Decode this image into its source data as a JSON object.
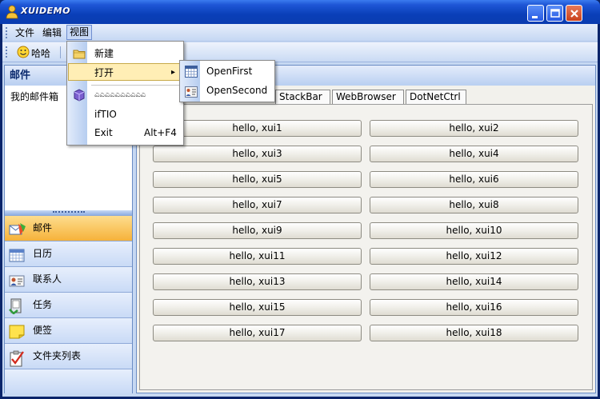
{
  "window": {
    "title": "XUIDEMO",
    "minimize_icon": "minimize-icon",
    "maximize_icon": "maximize-icon",
    "close_icon": "close-icon"
  },
  "menubar": {
    "items": [
      {
        "label": "文件"
      },
      {
        "label": "编辑"
      },
      {
        "label": "视图"
      }
    ]
  },
  "toolbar": {
    "items": [
      {
        "label": "哈哈",
        "icon": "smiley-icon"
      }
    ]
  },
  "left_panel": {
    "header": "邮件",
    "tree_item": "我的邮件箱",
    "nav": [
      {
        "label": "邮件",
        "icon": "mail-icon",
        "active": true
      },
      {
        "label": "日历",
        "icon": "calendar-icon",
        "active": false
      },
      {
        "label": "联系人",
        "icon": "contact-card-icon",
        "active": false
      },
      {
        "label": "任务",
        "icon": "task-icon",
        "active": false
      },
      {
        "label": "便签",
        "icon": "note-icon",
        "active": false
      },
      {
        "label": "文件夹列表",
        "icon": "checklist-icon",
        "active": false
      }
    ]
  },
  "right_panel": {
    "tabs": [
      {
        "label": "StackBar"
      },
      {
        "label": "WebBrowser"
      },
      {
        "label": "DotNetCtrl"
      }
    ],
    "buttons": [
      "hello, xui1",
      "hello, xui2",
      "hello, xui3",
      "hello, xui4",
      "hello, xui5",
      "hello, xui6",
      "hello, xui7",
      "hello, xui8",
      "hello, xui9",
      "hello, xui10",
      "hello, xui11",
      "hello, xui12",
      "hello, xui13",
      "hello, xui14",
      "hello, xui15",
      "hello, xui16",
      "hello, xui17",
      "hello, xui18"
    ]
  },
  "view_menu": {
    "items": [
      {
        "label": "新建",
        "icon": "folder-icon"
      },
      {
        "label": "打开",
        "icon": "",
        "submenu_arrow": "▸"
      },
      {
        "label": "ಎಎಎಎಎಎಎಎಎಎ",
        "icon": "cube-icon"
      },
      {
        "label": "ifTIO",
        "icon": ""
      },
      {
        "label": "Exit",
        "shortcut": "Alt+F4",
        "icon": ""
      }
    ]
  },
  "open_submenu": {
    "items": [
      {
        "label": "OpenFirst",
        "icon": "calendar-grid-icon"
      },
      {
        "label": "OpenSecond",
        "icon": "contact-card-icon"
      }
    ]
  },
  "colors": {
    "titlebar": "#1e56d6",
    "menu_highlight": "#ffeeb5",
    "active_nav": "#f6b23a"
  }
}
